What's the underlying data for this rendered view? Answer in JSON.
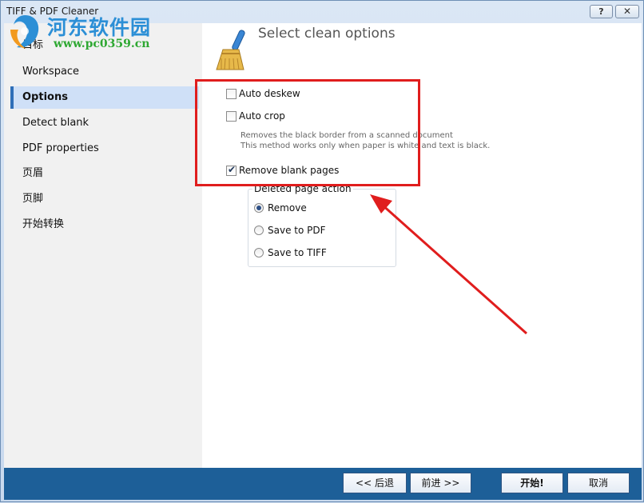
{
  "window": {
    "title": "TIFF & PDF Cleaner",
    "help_label": "?",
    "close_label": "✕"
  },
  "watermark": {
    "title": "河东软件园",
    "url": "www.pc0359.cn"
  },
  "sidebar": {
    "items": [
      {
        "label": "目标",
        "active": false
      },
      {
        "label": "Workspace",
        "active": false
      },
      {
        "label": "Options",
        "active": true
      },
      {
        "label": "Detect blank",
        "active": false
      },
      {
        "label": "PDF properties",
        "active": false
      },
      {
        "label": "页眉",
        "active": false
      },
      {
        "label": "页脚",
        "active": false
      },
      {
        "label": "开始转换",
        "active": false
      }
    ]
  },
  "main": {
    "title": "Select clean options",
    "auto_deskew": {
      "label": "Auto deskew",
      "checked": false
    },
    "auto_crop": {
      "label": "Auto crop",
      "checked": false
    },
    "auto_crop_desc_1": "Removes the black border from a scanned document",
    "auto_crop_desc_2": "This method works only when paper is white and text is black.",
    "remove_blank": {
      "label": "Remove blank pages",
      "checked": true
    },
    "deleted_page_action": {
      "title": "Deleted page action",
      "options": [
        {
          "label": "Remove",
          "selected": true
        },
        {
          "label": "Save to PDF",
          "selected": false
        },
        {
          "label": "Save to TIFF",
          "selected": false
        }
      ]
    }
  },
  "footer": {
    "back_label": "<< 后退",
    "next_label": "前进 >>",
    "start_label": "开始!",
    "cancel_label": "取消"
  },
  "colors": {
    "annotation": "#e01d1d",
    "footer_bg": "#1d5f98",
    "selected_item_bg": "#cfe0f7"
  },
  "icons": [
    "broom-icon",
    "help-icon",
    "close-icon",
    "watermark-logo-icon",
    "annotation-arrow-icon"
  ]
}
